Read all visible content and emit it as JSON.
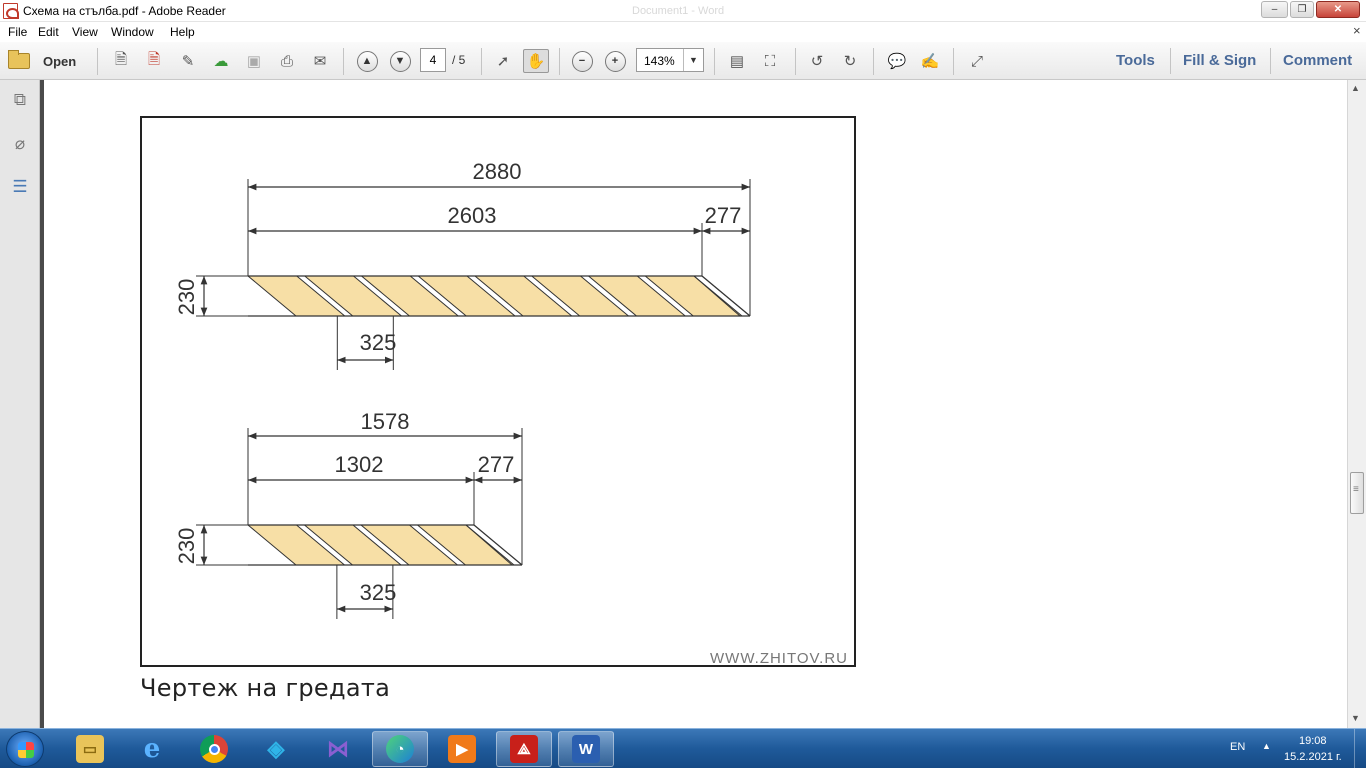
{
  "window": {
    "title": "Схема на стълба.pdf - Adobe Reader",
    "faded_title": "Document1 - Word",
    "minimize": "–",
    "maximize": "❐",
    "close": "✕"
  },
  "menu": {
    "items": [
      "File",
      "Edit",
      "View",
      "Window",
      "Help"
    ],
    "close_doc": "×"
  },
  "toolbar": {
    "open_label": "Open",
    "page_current": "4",
    "page_total": "/ 5",
    "zoom": "143%",
    "zoom_drop": "▼",
    "tools": "Tools",
    "fill_sign": "Fill & Sign",
    "comment": "Comment",
    "icons": [
      "create-pdf-icon",
      "export-pdf-icon",
      "edit-icon",
      "cloud-upload-icon",
      "save-icon",
      "print-icon",
      "email-icon",
      "prev-page-icon",
      "next-page-icon",
      "select-arrow-icon",
      "hand-icon",
      "zoom-out-icon",
      "zoom-in-icon",
      "fit-page-icon",
      "fullscreen-fit-icon",
      "rotate-ccw-icon",
      "rotate-cw-icon",
      "comment-bubble-icon",
      "highlight-icon",
      "expand-icon"
    ]
  },
  "figure": {
    "watermark": "WWW.ZHITOV.RU",
    "top": {
      "total": "2880",
      "main": "2603",
      "end": "277",
      "height": "230",
      "step": "325"
    },
    "bottom": {
      "total": "1578",
      "main": "1302",
      "end": "277",
      "height": "230",
      "step": "325"
    },
    "fill_color": "#f7dfa6",
    "stroke_color": "#333333"
  },
  "caption": "Чертеж на гредата",
  "taskbar": {
    "apps": [
      "file-explorer-icon",
      "internet-explorer-icon",
      "chrome-icon",
      "kodi-icon",
      "visual-studio-icon",
      "edge-icon",
      "media-player-icon",
      "adobe-reader-icon",
      "word-icon"
    ],
    "lang": "EN",
    "tray_arrow": "▲",
    "time": "19:08",
    "date": "15.2.2021 г."
  }
}
